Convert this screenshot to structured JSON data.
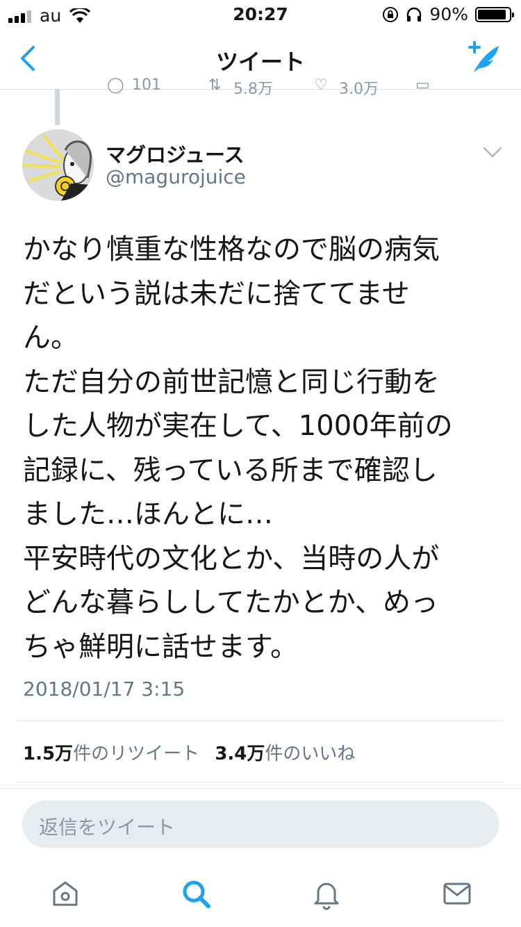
{
  "status_bar": {
    "carrier": "au",
    "time": "20:27",
    "battery_percent": "90%",
    "battery_level": 0.9,
    "icons": [
      "signal-icon",
      "wifi-icon",
      "orientation-lock-icon",
      "headphones-icon",
      "battery-icon"
    ]
  },
  "nav": {
    "title": "ツイート",
    "back_icon": "chevron-left-icon",
    "compose_icon": "compose-tweet-icon"
  },
  "previous_tweet_actions": {
    "reply_count": "101",
    "retweet_count": "5.8万",
    "like_count": "3.0万"
  },
  "tweet": {
    "display_name": "マグロジュース",
    "handle": "@magurojuice",
    "text": "かなり慎重な性格なので脳の病気\nだという説は未だに捨ててませ\nん。\nただ自分の前世記憶と同じ行動を\nした人物が実在して、1000年前の\n記録に、残っている所まで確認し\nました…ほんとに…\n平安時代の文化とか、当時の人が\nどんな暮らししてたかとか、めっ\nちゃ鮮明に話せます。",
    "timestamp": "2018/01/17 3:15",
    "retweet_count": "1.5万",
    "retweet_label": "件のリツイート",
    "like_count": "3.4万",
    "like_label": "件のいいね"
  },
  "reply": {
    "placeholder": "返信をツイート"
  },
  "tabbar": {
    "items": [
      "home-icon",
      "search-icon",
      "notifications-icon",
      "messages-icon"
    ],
    "active": "search-icon"
  },
  "colors": {
    "accent": "#1da1f2",
    "text": "#14171a",
    "secondary": "#657786",
    "divider": "#e1e8ed",
    "reply_bg": "#e6ecf0",
    "inactive_icon": "#657786"
  }
}
